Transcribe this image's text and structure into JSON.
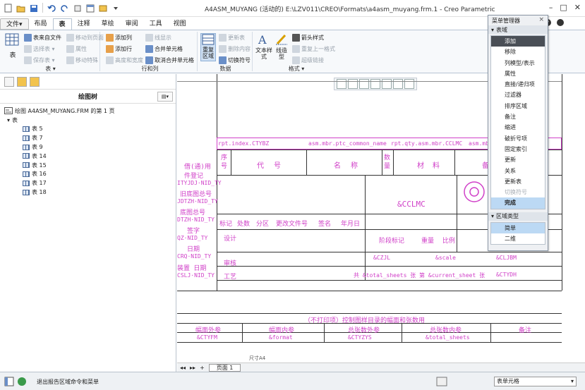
{
  "window": {
    "title": "A4ASM_MUYANG (活动的) E:\\LZV011\\CREO\\Formats\\a4asm_muyang.frm.1 - Creo Parametric"
  },
  "ribbon_tabs": [
    "文件▾",
    "布局",
    "表",
    "注释",
    "草绘",
    "审阅",
    "工具",
    "视图"
  ],
  "ribbon": {
    "groups": {
      "table": {
        "label": "表 ▾",
        "table_button": "表",
        "from_file": "表来自文件",
        "move_to_page": "移动到页面",
        "select_table": "选择表 ▾",
        "properties": "属性",
        "save_table": "保存表 ▾",
        "move_special": "移动特殊"
      },
      "rows_cols": {
        "label": "行和列",
        "add_column": "添加列",
        "add_row": "添加行",
        "height_width": "高度和宽度",
        "line_display": "线显示",
        "merge_cells": "合并单元格",
        "unmerge_cells": "取消合并单元格"
      },
      "data": {
        "label": "数据",
        "repeat_region": "重复区域",
        "update_table": "更新表",
        "delete_content": "删除内容",
        "switch_symbol": "切换符号"
      },
      "format": {
        "label": "格式 ▾",
        "text_style": "文本样式",
        "line_style": "线造型",
        "arrow_style": "箭头样式",
        "repeat_last_format": "重复上一格式",
        "hyperlink": "超级链接"
      }
    }
  },
  "left_panel": {
    "header": "绘图树",
    "root": "绘图 A4ASM_MUYANG.FRM 的第 1 页",
    "tables_label": "表",
    "tables": [
      "表 5",
      "表 7",
      "表 9",
      "表 14",
      "表 15",
      "表 16",
      "表 17",
      "表 18"
    ]
  },
  "menu_manager": {
    "title": "菜单管理器",
    "section_table_region": "表域",
    "items": [
      "添加",
      "移除",
      "列模型/表示",
      "属性",
      "直接/递归项",
      "过滤器",
      "排序区域",
      "备注",
      "缩进",
      "破折号项",
      "固定索引",
      "更新",
      "关系",
      "更新表",
      "切换符号",
      "完成"
    ],
    "selected_item": "添加",
    "disabled_items": [
      "切换符号"
    ],
    "highlighted_item": "完成",
    "section_region_type": "区域类型",
    "type_items": [
      "简单",
      "二维"
    ],
    "type_highlighted": "简单"
  },
  "drawing": {
    "row1_a": "rpt.index.CTYBZ",
    "row1_b": "asm.mbr.ptc_common_name",
    "row1_c": "rpt.qty.asm.mbr.CCLMC",
    "row1_d": "asm.mbr.CTYBZ",
    "hdr_xuhao": "序号",
    "hdr_daihao": "代号",
    "hdr_mingcheng": "名称",
    "hdr_shuliang": "数量",
    "hdr_cailiao": "材料",
    "hdr_bei": "备",
    "left_1": "借(通)用",
    "left_2": "件登记",
    "left_3": "ITYJDJ·NID_TY",
    "left_4": "旧底图总号",
    "left_5": "JDTZH·NID_TY",
    "left_6": "底图总号",
    "left_7": "DTZH·NID_TY",
    "left_8": "签字",
    "left_9": "QZ·NID_TY",
    "left_10": "日期",
    "left_11": "CRQ·NID_TY",
    "left_12": "装置  日期",
    "left_13": "CSLJ·NID_TY",
    "cclmc": "&CCLMC",
    "biaoji": "标记",
    "chushu": "处数",
    "fenqu": "分区",
    "genggai": "更改文件号",
    "qianzi": "签名",
    "nianyueri": "年月日",
    "sheji": "设计",
    "jieduan": "阶段标记",
    "zhongliang": "重量",
    "bili": "比例",
    "shenhe": "审核",
    "gongyi": "工艺",
    "scale": "&scale",
    "cljbm": "&CLJBM",
    "total_sheets_row": "共 &total_sheets 张  第 &current_sheet 张",
    "ctydh": "&CTYDH",
    "dwg_name": "&CZJL",
    "bottom_title": "（不打印项）控制图样目录的幅面和张数用",
    "bottom_h1": "幅面外参",
    "bottom_h2": "幅面内参",
    "bottom_h3": "总张数外参",
    "bottom_h4": "总张数内参",
    "bottom_h5": "备注",
    "bottom_v1": "&CTYFM",
    "bottom_v2": "&format",
    "bottom_v3": "&CTYZYS",
    "bottom_v4": "&total_sheets",
    "size_label": "尺寸A4"
  },
  "page_tabs": {
    "page1": "页面 1"
  },
  "status": {
    "message": "退出报告区域命令和菜单",
    "filter": "表单元格"
  }
}
